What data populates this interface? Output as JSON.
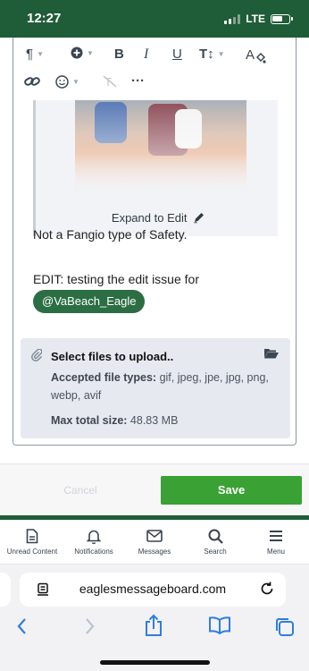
{
  "status_bar": {
    "time": "12:27",
    "network": "LTE"
  },
  "toolbar": {
    "buttons": [
      "paragraph-icon",
      "insert-icon",
      "bold-icon",
      "italic-icon",
      "underline-icon",
      "text-size-icon",
      "text-color-icon",
      "link-icon",
      "emoji-icon",
      "clear-format-icon",
      "more-icon"
    ],
    "bold": "B",
    "italic": "I",
    "underline": "U"
  },
  "quote": {
    "expand_label": "Expand to Edit"
  },
  "post": {
    "line1": "Not a Fangio type of Safety.",
    "line2": "EDIT:  testing the edit issue for",
    "mention": "@VaBeach_Eagle"
  },
  "upload": {
    "title": "Select files to upload..",
    "types_label": "Accepted file types:",
    "types_value": "gif, jpeg, jpe, jpg, png, webp, avif",
    "size_label": "Max total size:",
    "size_value": "48.83 MB"
  },
  "actions": {
    "cancel_label": "Cancel",
    "save_label": "Save"
  },
  "nav": {
    "items": [
      {
        "label": "Unread Content",
        "icon": "document-icon"
      },
      {
        "label": "Notifications",
        "icon": "bell-icon"
      },
      {
        "label": "Messages",
        "icon": "envelope-icon"
      },
      {
        "label": "Search",
        "icon": "search-icon"
      },
      {
        "label": "Menu",
        "icon": "hamburger-icon"
      }
    ]
  },
  "browser": {
    "url": "eaglesmessageboard.com"
  },
  "colors": {
    "brand_green": "#1f5c38",
    "save_green": "#3aa135",
    "mention_green": "#2c6e43",
    "ios_blue": "#2f7de1"
  }
}
